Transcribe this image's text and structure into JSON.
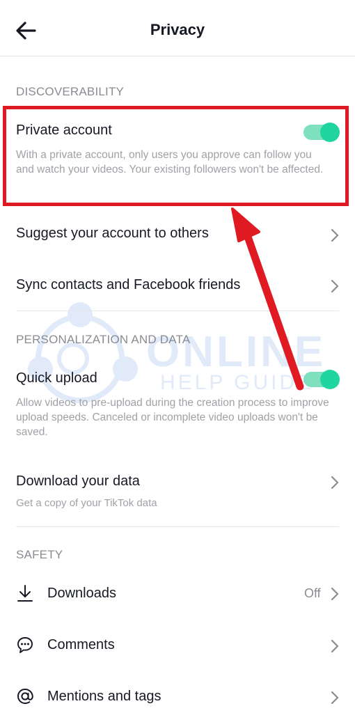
{
  "header": {
    "title": "Privacy",
    "back_icon": "arrow-left-icon"
  },
  "discoverability": {
    "heading": "DISCOVERABILITY",
    "private_account": {
      "label": "Private account",
      "description": "With a private account, only users you approve can follow you and watch your videos. Your existing followers won't be affected.",
      "enabled": true
    },
    "suggest": {
      "label": "Suggest your account to others"
    },
    "sync": {
      "label": "Sync contacts and Facebook friends"
    }
  },
  "personalization": {
    "heading": "PERSONALIZATION AND DATA",
    "quick_upload": {
      "label": "Quick upload",
      "description": "Allow videos to pre-upload during the creation process to improve upload speeds. Canceled or incomplete video uploads won't be saved.",
      "enabled": true
    },
    "download_data": {
      "label": "Download your data",
      "description": "Get a copy of your TikTok data"
    }
  },
  "safety": {
    "heading": "SAFETY",
    "downloads": {
      "label": "Downloads",
      "value": "Off",
      "icon": "download-icon"
    },
    "comments": {
      "label": "Comments",
      "icon": "comment-icon"
    },
    "mentions": {
      "label": "Mentions and tags",
      "icon": "at-sign-icon"
    }
  },
  "watermark": {
    "line1": "ONLINE",
    "line2": "HELP GUIDE"
  },
  "colors": {
    "toggle_on": "#20d5a0",
    "highlight": "#e01a22",
    "text_secondary": "#8a8b91"
  }
}
